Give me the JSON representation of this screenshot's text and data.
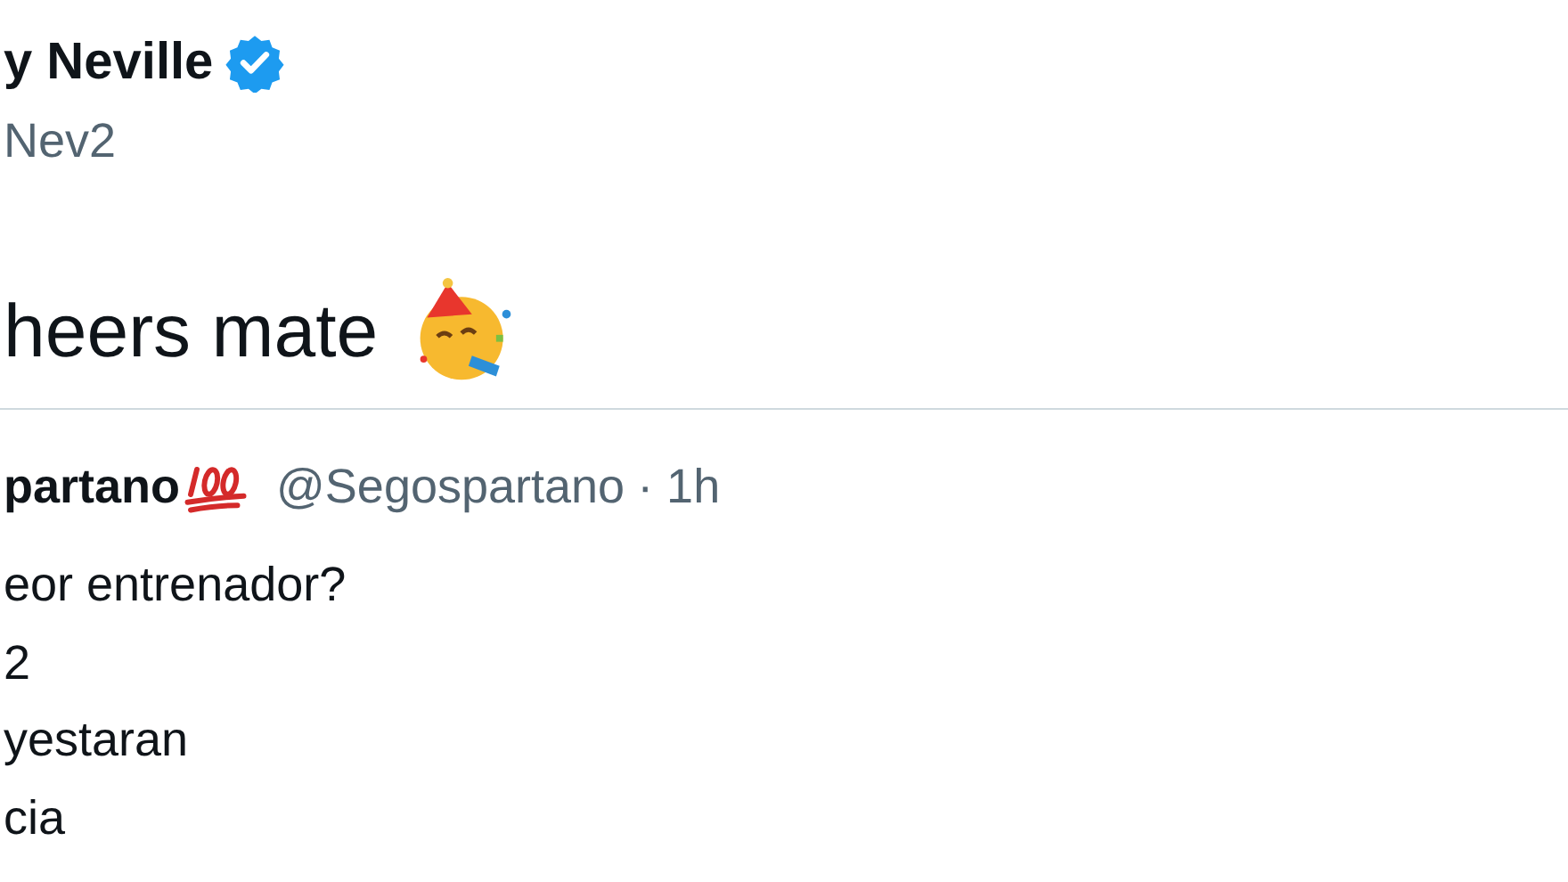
{
  "tweet": {
    "author_name": "y Neville",
    "verified": true,
    "handle": "Nev2",
    "text": "heers mate"
  },
  "quoted_tweet": {
    "author_name": "partano",
    "handle": "@Segospartano",
    "time": "· 1h",
    "lines": [
      "eor entrenador?",
      "2",
      "yestaran",
      "cia"
    ]
  }
}
